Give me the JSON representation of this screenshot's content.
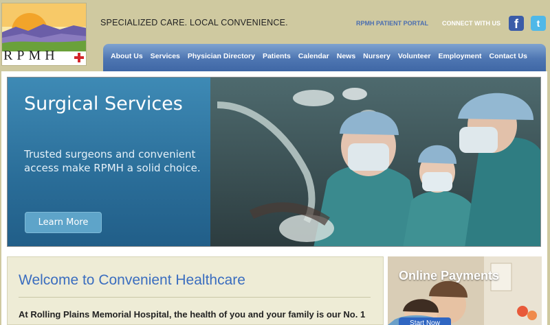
{
  "header": {
    "logo_text": "RPMH",
    "tagline": "SPECIALIZED CARE. LOCAL CONVENIENCE.",
    "portal_link": "RPMH PATIENT PORTAL",
    "connect_label": "CONNECT WITH US",
    "facebook_glyph": "f",
    "twitter_glyph": "t"
  },
  "nav": {
    "items": [
      "About Us",
      "Services",
      "Physician Directory",
      "Patients",
      "Calendar",
      "News",
      "Nursery",
      "Volunteer",
      "Employment",
      "Contact Us"
    ]
  },
  "hero": {
    "title": "Surgical Services",
    "description": "Trusted surgeons and convenient access make RPMH a solid choice.",
    "button_label": "Learn More"
  },
  "welcome": {
    "title": "Welcome to Convenient Healthcare",
    "body": "At Rolling Plains Memorial Hospital, the health of you and your family is our No. 1"
  },
  "payments": {
    "title": "Online Payments",
    "button_label": "Start Now"
  },
  "icons": {
    "logo": "landscape-logo-icon",
    "cross": "red-cross-icon",
    "facebook": "facebook-icon",
    "twitter": "twitter-icon"
  },
  "colors": {
    "background": "#cfc9a0",
    "nav": "#4e76b2",
    "accent_blue": "#3a6dbf",
    "cross_red": "#d3262b"
  }
}
